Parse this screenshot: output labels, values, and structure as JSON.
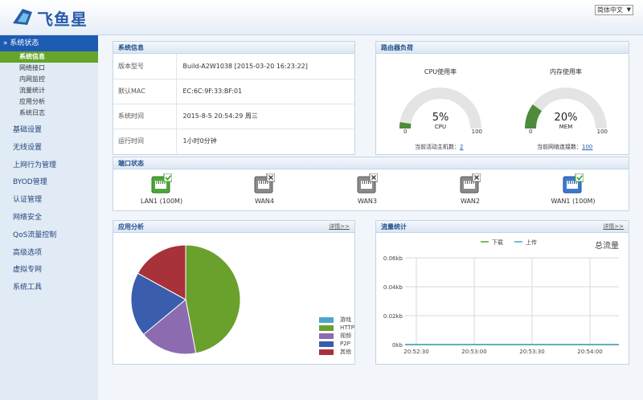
{
  "header": {
    "brand": "飞鱼星",
    "language": "简体中文"
  },
  "sidebar": {
    "group_label": "系统状态",
    "sub_items": [
      "系统信息",
      "网络接口",
      "内网监控",
      "流量统计",
      "应用分析",
      "系统日志"
    ],
    "items": [
      "基础设置",
      "无线设置",
      "上网行为管理",
      "BYOD管理",
      "认证管理",
      "网络安全",
      "QoS流量控制",
      "高级选项",
      "虚拟专网",
      "系统工具"
    ]
  },
  "sysinfo": {
    "title": "系统信息",
    "rows": [
      {
        "k": "版本型号",
        "v": "Build-A2W1038 [2015-03-20 16:23:22]"
      },
      {
        "k": "默认MAC",
        "v": "EC:6C:9F:33:BF:01"
      },
      {
        "k": "系统时间",
        "v": "2015-8-5 20:54:29 周三"
      },
      {
        "k": "运行时间",
        "v": "1小时0分钟"
      }
    ]
  },
  "load": {
    "title": "路由器负荷",
    "cpu": {
      "title": "CPU使用率",
      "value": "5%",
      "label": "CPU",
      "min": "0",
      "max": "100",
      "percent": 5
    },
    "mem": {
      "title": "内存使用率",
      "value": "20%",
      "label": "MEM",
      "min": "0",
      "max": "100",
      "percent": 20
    },
    "hosts_label": "当前活动主机数：",
    "hosts_value": "2",
    "conns_label": "当前网络连接数：",
    "conns_value": "100"
  },
  "ports": {
    "title": "端口状态",
    "list": [
      {
        "name": "LAN1 (100M)",
        "state": "up",
        "color": "green"
      },
      {
        "name": "WAN4",
        "state": "down",
        "color": "gray"
      },
      {
        "name": "WAN3",
        "state": "down",
        "color": "gray"
      },
      {
        "name": "WAN2",
        "state": "down",
        "color": "gray"
      },
      {
        "name": "WAN1 (100M)",
        "state": "up",
        "color": "blue"
      }
    ]
  },
  "apps": {
    "title": "应用分析",
    "more": "详情>>",
    "legend": [
      {
        "name": "游戏",
        "color": "#4aa7c9"
      },
      {
        "name": "HTTP",
        "color": "#6aa02c"
      },
      {
        "name": "视频",
        "color": "#8c6bb1"
      },
      {
        "name": "P2P",
        "color": "#3a5dad"
      },
      {
        "name": "其他",
        "color": "#a8323a"
      }
    ]
  },
  "traffic": {
    "title": "流量统计",
    "more": "详情>>",
    "total_label": "总流量"
  },
  "chart_data": [
    {
      "type": "pie",
      "categories": [
        "游戏",
        "HTTP",
        "视频",
        "P2P",
        "其他"
      ],
      "values": [
        0,
        47,
        17,
        19,
        17
      ],
      "colors": [
        "#4aa7c9",
        "#6aa02c",
        "#8c6bb1",
        "#3a5dad",
        "#a8323a"
      ]
    },
    {
      "type": "line",
      "title": "总流量",
      "x": [
        "20:52:30",
        "20:53:00",
        "20:53:30",
        "20:54:00"
      ],
      "series": [
        {
          "name": "下载",
          "color": "#5aa02c",
          "values": [
            0,
            0,
            0,
            0
          ]
        },
        {
          "name": "上传",
          "color": "#4aa7c9",
          "values": [
            0,
            0,
            0,
            0
          ]
        }
      ],
      "y_ticks": [
        "0kb",
        "0.02kb",
        "0.04kb",
        "0.06kb"
      ],
      "ylim": [
        0,
        0.06
      ],
      "grid": true,
      "legend": "top"
    }
  ]
}
